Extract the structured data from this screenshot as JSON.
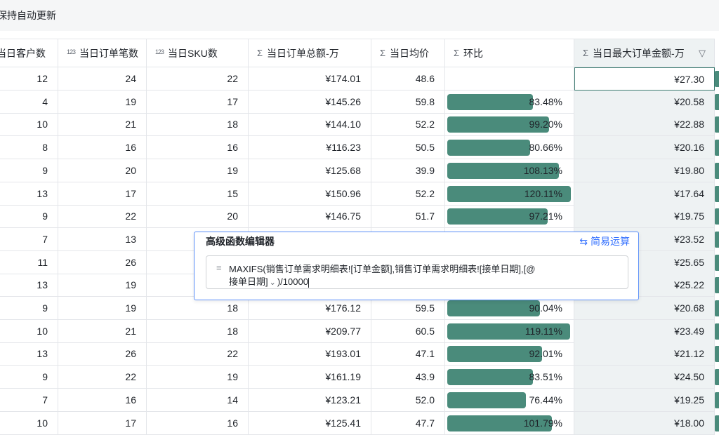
{
  "topbar": {
    "status": "保持自动更新"
  },
  "columns": [
    {
      "label": "当日客户数",
      "icon": ""
    },
    {
      "label": "当日订单笔数",
      "icon": "123"
    },
    {
      "label": "当日SKU数",
      "icon": "123"
    },
    {
      "label": "当日订单总额-万",
      "icon": "Σ"
    },
    {
      "label": "当日均价",
      "icon": "Σ"
    },
    {
      "label": "环比",
      "icon": "Σ"
    },
    {
      "label": "当日最大订单金额-万",
      "icon": "Σ"
    }
  ],
  "rows": [
    {
      "c": "12",
      "o": "24",
      "s": "22",
      "t": "¥174.01",
      "a": "48.6",
      "r": "",
      "rv": 0,
      "m": "¥27.30"
    },
    {
      "c": "4",
      "o": "19",
      "s": "17",
      "t": "¥145.26",
      "a": "59.8",
      "r": "83.48%",
      "rv": 0.8348,
      "m": "¥20.58"
    },
    {
      "c": "10",
      "o": "21",
      "s": "18",
      "t": "¥144.10",
      "a": "52.2",
      "r": "99.20%",
      "rv": 0.992,
      "m": "¥22.88"
    },
    {
      "c": "8",
      "o": "16",
      "s": "16",
      "t": "¥116.23",
      "a": "50.5",
      "r": "80.66%",
      "rv": 0.8066,
      "m": "¥20.16"
    },
    {
      "c": "9",
      "o": "20",
      "s": "19",
      "t": "¥125.68",
      "a": "39.9",
      "r": "108.13%",
      "rv": 1.0813,
      "m": "¥19.80"
    },
    {
      "c": "13",
      "o": "17",
      "s": "15",
      "t": "¥150.96",
      "a": "52.2",
      "r": "120.11%",
      "rv": 1.2011,
      "m": "¥17.64"
    },
    {
      "c": "9",
      "o": "22",
      "s": "20",
      "t": "¥146.75",
      "a": "51.7",
      "r": "97.21%",
      "rv": 0.9721,
      "m": "¥19.75"
    },
    {
      "c": "7",
      "o": "13",
      "s": "",
      "t": "",
      "a": "",
      "r": "",
      "rv": 0,
      "m": "¥23.52"
    },
    {
      "c": "11",
      "o": "26",
      "s": "",
      "t": "",
      "a": "",
      "r": "",
      "rv": 0,
      "m": "¥25.65"
    },
    {
      "c": "13",
      "o": "19",
      "s": "",
      "t": "",
      "a": "",
      "r": "",
      "rv": 0,
      "m": "¥25.22"
    },
    {
      "c": "9",
      "o": "19",
      "s": "18",
      "t": "¥176.12",
      "a": "59.5",
      "r": "90.04%",
      "rv": 0.9004,
      "m": "¥20.68"
    },
    {
      "c": "10",
      "o": "21",
      "s": "18",
      "t": "¥209.77",
      "a": "60.5",
      "r": "119.11%",
      "rv": 1.1911,
      "m": "¥23.49"
    },
    {
      "c": "13",
      "o": "26",
      "s": "22",
      "t": "¥193.01",
      "a": "47.1",
      "r": "92.01%",
      "rv": 0.9201,
      "m": "¥21.12"
    },
    {
      "c": "9",
      "o": "22",
      "s": "19",
      "t": "¥161.19",
      "a": "43.9",
      "r": "83.51%",
      "rv": 0.8351,
      "m": "¥24.50"
    },
    {
      "c": "7",
      "o": "16",
      "s": "14",
      "t": "¥123.21",
      "a": "52.0",
      "r": "76.44%",
      "rv": 0.7644,
      "m": "¥19.25"
    },
    {
      "c": "10",
      "o": "17",
      "s": "16",
      "t": "¥125.41",
      "a": "47.7",
      "r": "101.79%",
      "rv": 1.0179,
      "m": "¥18.00"
    }
  ],
  "editor": {
    "title": "高级函数编辑器",
    "mode_label": "简易运算",
    "eq": "=",
    "line1": "MAXIFS(销售订单需求明细表![订单金额],销售订单需求明细表![接单日期],[@",
    "line2_field": "接单日期]",
    "line2_rest": ")/10000"
  },
  "colors": {
    "bar": "#4a8b7b",
    "accent": "#3370ff"
  }
}
